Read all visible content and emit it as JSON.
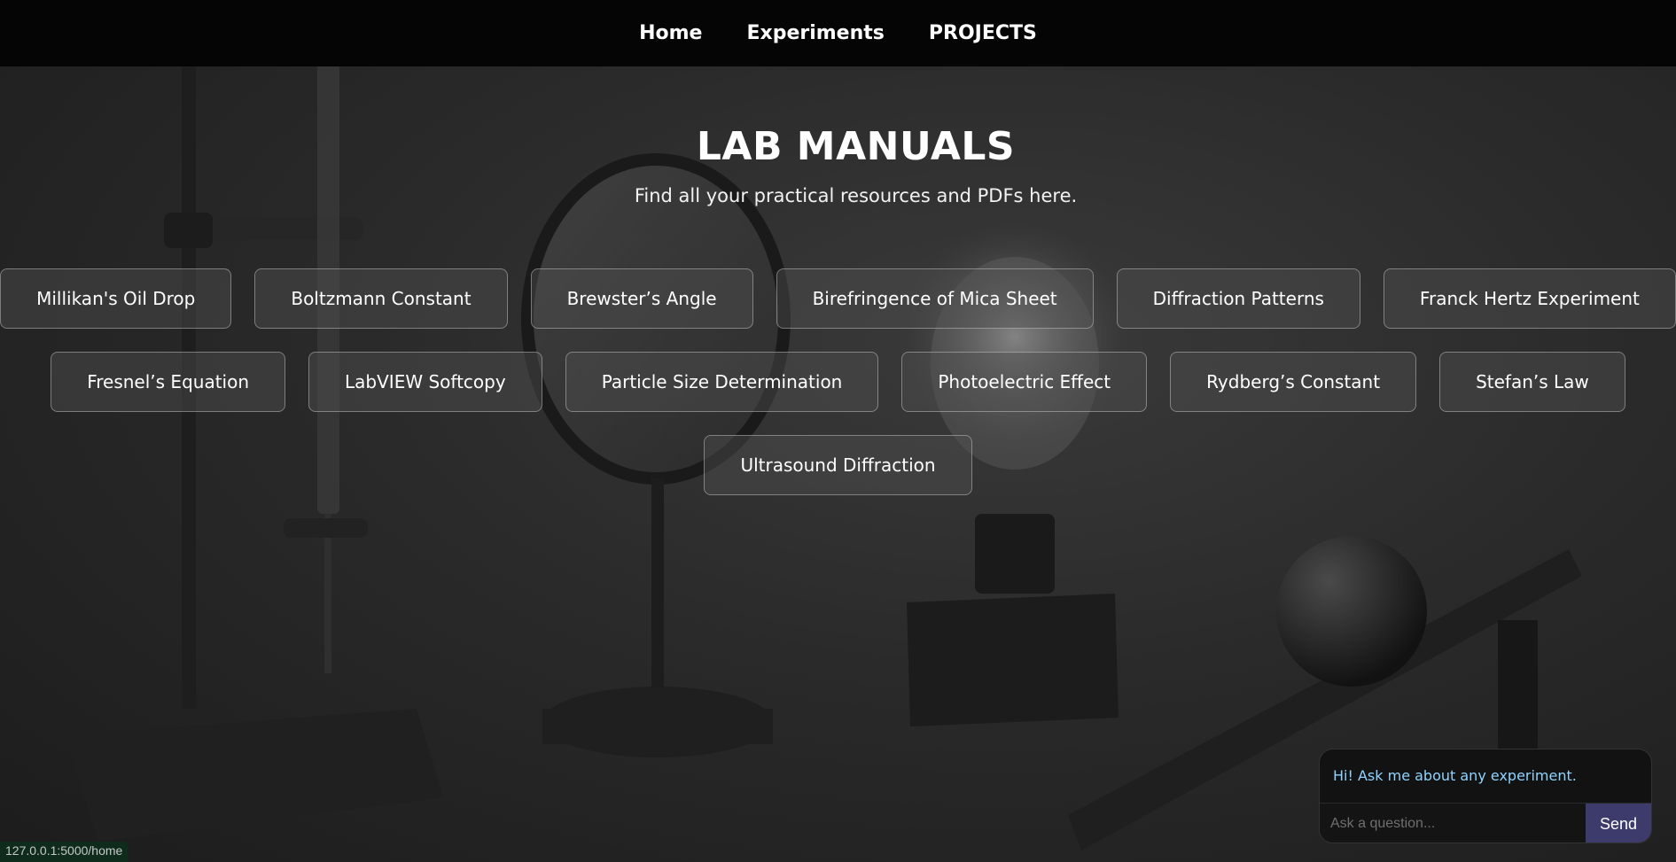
{
  "nav": {
    "items": [
      {
        "label": "Home"
      },
      {
        "label": "Experiments"
      },
      {
        "label": "PROJECTS"
      }
    ]
  },
  "hero": {
    "title": "LAB MANUALS",
    "subtitle": "Find all your practical resources and PDFs here."
  },
  "manuals": {
    "row1": [
      "Millikan's Oil Drop",
      "Boltzmann Constant",
      "Brewster’s Angle",
      "Birefringence of Mica Sheet",
      "Diffraction Patterns",
      "Franck Hertz Experiment"
    ],
    "row2": [
      "Fresnel’s Equation",
      "LabVIEW Softcopy",
      "Particle Size Determination",
      "Photoelectric Effect",
      "Rydberg’s Constant",
      "Stefan’s Law"
    ],
    "row3": [
      "Ultrasound Diffraction"
    ]
  },
  "chat": {
    "greeting": "Hi! Ask me about any experiment.",
    "placeholder": "Ask a question...",
    "send_label": "Send"
  },
  "status": {
    "url": "127.0.0.1:5000/home"
  },
  "colors": {
    "nav_bg": "#050505",
    "chat_greeting": "#8fd3ff",
    "send_button": "#3d3b6b",
    "status_bg": "#0e2b1c"
  }
}
